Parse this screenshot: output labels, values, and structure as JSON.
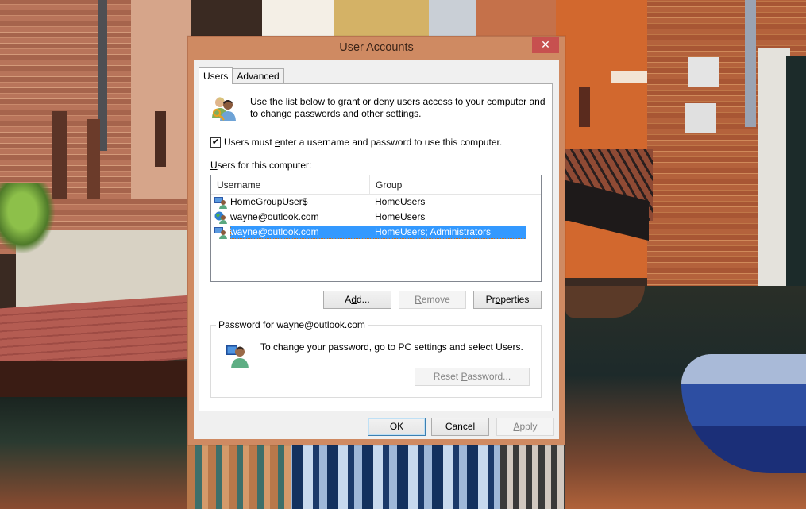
{
  "dialog": {
    "title": "User Accounts",
    "close_label": "✕",
    "frame_color": "#cf8a62",
    "close_color": "#c7504f"
  },
  "tabs": [
    {
      "label": "Users",
      "active": true
    },
    {
      "label": "Advanced",
      "active": false
    }
  ],
  "users_tab": {
    "intro_icon": "users-key-icon",
    "intro_text": "Use the list below to grant or deny users access to your computer and to change passwords and other settings.",
    "require_login": {
      "checked": true,
      "check_glyph": "✔",
      "label_before": "Users must ",
      "label_access": "e",
      "label_after": "nter a username and password to use this computer."
    },
    "list_label_access": "U",
    "list_label_rest": "sers for this computer:",
    "list": {
      "columns": [
        "Username",
        "Group"
      ],
      "rows": [
        {
          "icon": "local-user-icon",
          "username": "HomeGroupUser$",
          "group": "HomeUsers",
          "selected": false
        },
        {
          "icon": "microsoft-account-icon",
          "username": "wayne@outlook.com",
          "group": "HomeUsers",
          "selected": false
        },
        {
          "icon": "local-user-icon",
          "username": "wayne@outlook.com",
          "group": "HomeUsers; Administrators",
          "selected": true
        }
      ],
      "selection_color": "#3399ff"
    },
    "buttons": {
      "add": {
        "before": "A",
        "access": "d",
        "after": "d...",
        "enabled": true
      },
      "remove": {
        "before": "",
        "access": "R",
        "after": "emove",
        "enabled": false
      },
      "properties": {
        "before": "Pr",
        "access": "o",
        "after": "perties",
        "enabled": true
      }
    },
    "password_group": {
      "legend": "Password for wayne@outlook.com",
      "icon": "user-computer-icon",
      "text": "To change your password, go to PC settings and select Users.",
      "reset_button": {
        "before": "Reset ",
        "access": "P",
        "after": "assword...",
        "enabled": false
      }
    }
  },
  "footer": {
    "ok": "OK",
    "cancel": "Cancel",
    "apply": {
      "access": "A",
      "after": "pply",
      "enabled": false
    }
  }
}
